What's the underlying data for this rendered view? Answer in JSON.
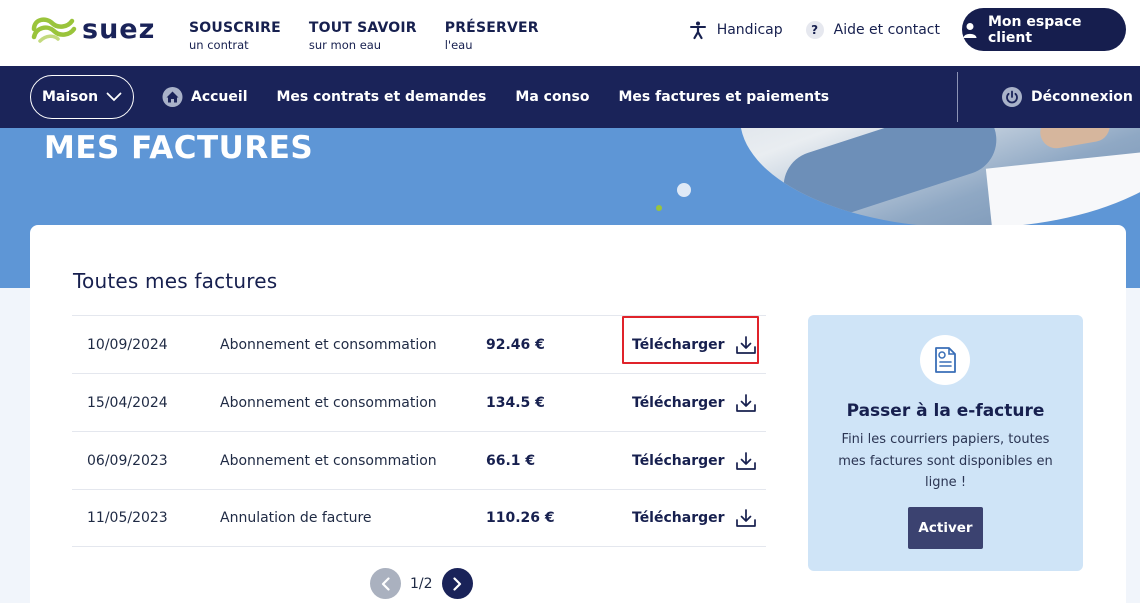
{
  "brand": {
    "name": "suez",
    "logo_icon": "suez-waves-logo",
    "accent": "#9ac43b",
    "navy": "#1a2359"
  },
  "top_nav": [
    {
      "main": "SOUSCRIRE",
      "sub": "un contrat"
    },
    {
      "main": "TOUT SAVOIR",
      "sub": "sur mon eau"
    },
    {
      "main": "PRÉSERVER",
      "sub": "l'eau"
    }
  ],
  "utilities": {
    "handicap": {
      "label": "Handicap",
      "icon": "accessibility-icon"
    },
    "help": {
      "label": "Aide et contact",
      "icon": "question-icon"
    },
    "client": {
      "label": "Mon espace client",
      "icon": "user-icon"
    }
  },
  "main_nav": {
    "selector": "Maison",
    "links": [
      "Accueil",
      "Mes contrats et demandes",
      "Ma conso",
      "Mes factures et paiements"
    ],
    "logout": "Déconnexion"
  },
  "hero": {
    "title": "MES FACTURES"
  },
  "invoices": {
    "title": "Toutes mes factures",
    "download_label": "Télécharger",
    "rows": [
      {
        "date": "10/09/2024",
        "label": "Abonnement et consommation",
        "amount": "92.46 €"
      },
      {
        "date": "15/04/2024",
        "label": "Abonnement et consommation",
        "amount": "134.5 €"
      },
      {
        "date": "06/09/2023",
        "label": "Abonnement et consommation",
        "amount": "66.1 €"
      },
      {
        "date": "11/05/2023",
        "label": "Annulation de facture",
        "amount": "110.26 €"
      }
    ],
    "pagination": "1/2"
  },
  "promo": {
    "title": "Passer à la e-facture",
    "text": "Fini les courriers papiers, toutes mes factures sont disponibles en ligne !",
    "button": "Activer",
    "icon": "e-invoice-icon"
  }
}
